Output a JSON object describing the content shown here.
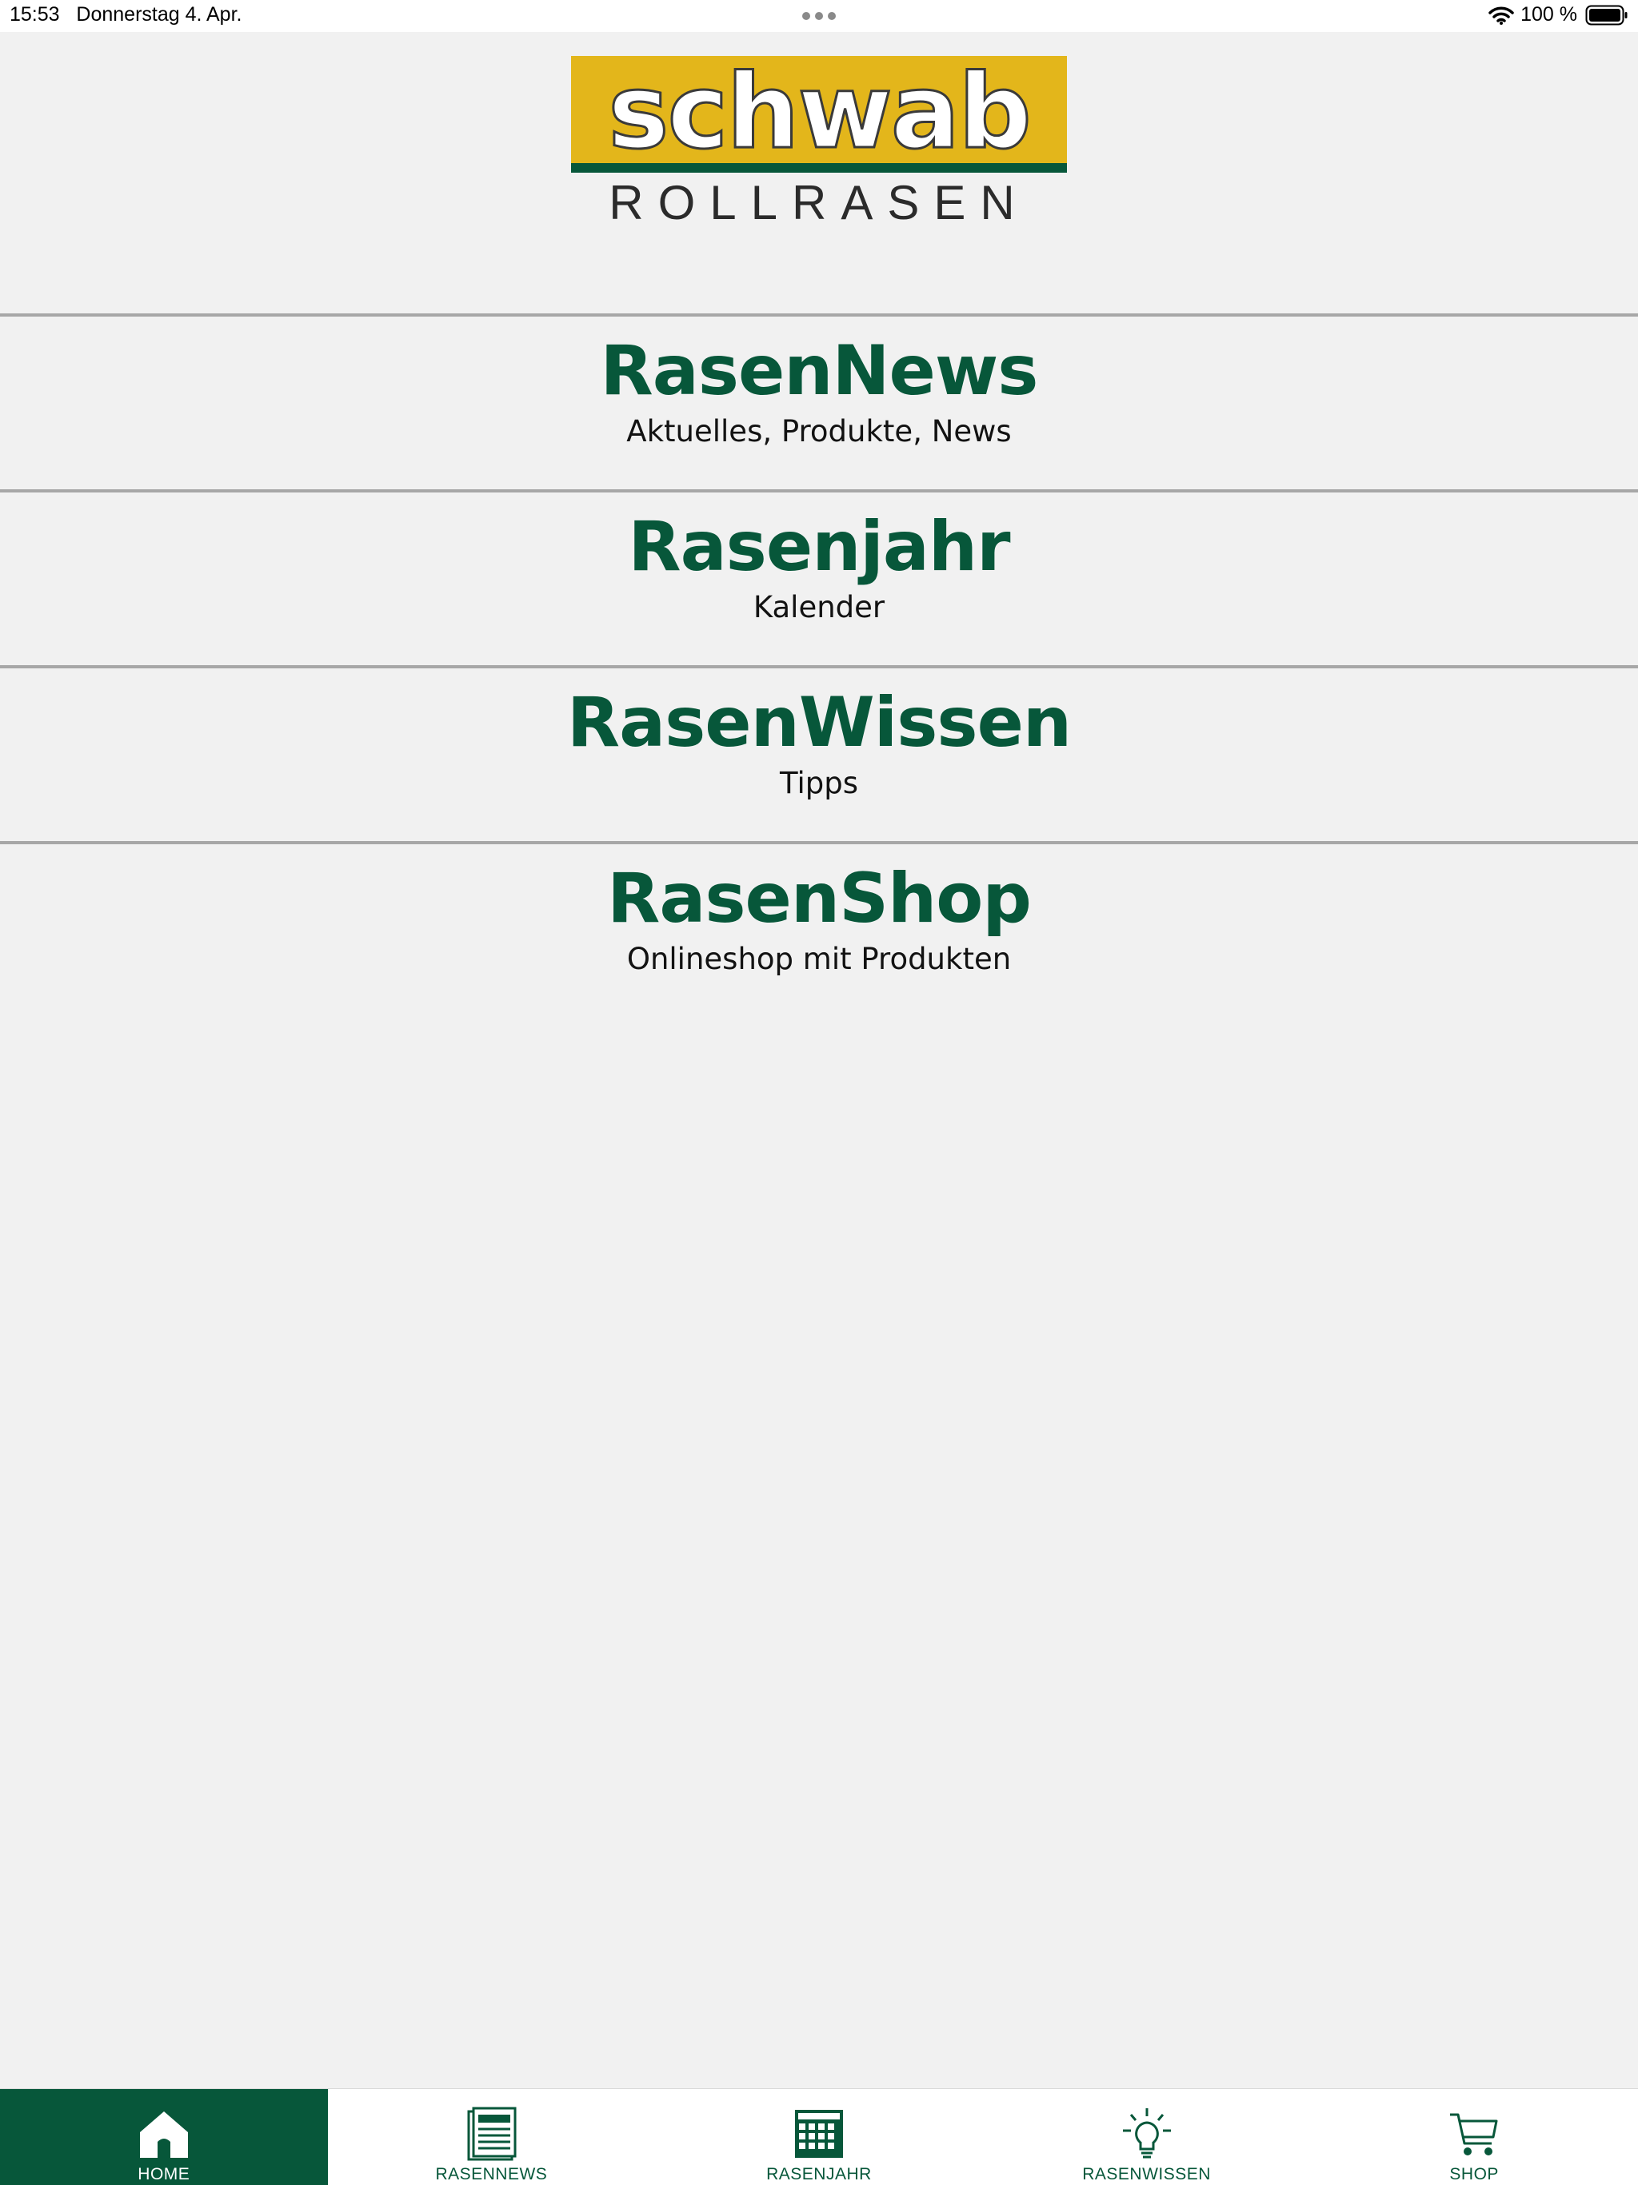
{
  "status_bar": {
    "time_date": "15:53   Donnerstag 4. Apr.",
    "battery": "100 %",
    "icons": [
      "more-dots-icon",
      "wifi-icon",
      "battery-icon"
    ]
  },
  "logo": {
    "wordmark": "schwab",
    "subtitle": "ROLLRASEN",
    "colors": {
      "yellow": "#e3b61b",
      "green": "#07573a",
      "text": "#2b2b2b"
    }
  },
  "menu": {
    "items": [
      {
        "title": "RasenNews",
        "subtitle": "Aktuelles, Produkte, News"
      },
      {
        "title": "Rasenjahr",
        "subtitle": "Kalender"
      },
      {
        "title": "RasenWissen",
        "subtitle": "Tipps"
      },
      {
        "title": "RasenShop",
        "subtitle": "Onlineshop mit Produkten"
      }
    ]
  },
  "tabbar": {
    "active_index": 0,
    "tabs": [
      {
        "label": "HOME",
        "icon": "home-icon"
      },
      {
        "label": "RASENNEWS",
        "icon": "newspaper-icon"
      },
      {
        "label": "RASENJAHR",
        "icon": "calendar-icon"
      },
      {
        "label": "RASENWISSEN",
        "icon": "lightbulb-icon"
      },
      {
        "label": "SHOP",
        "icon": "cart-icon"
      }
    ]
  },
  "colors": {
    "accent": "#07573a",
    "background": "#f1f1f1",
    "divider": "#a7a7a7"
  }
}
